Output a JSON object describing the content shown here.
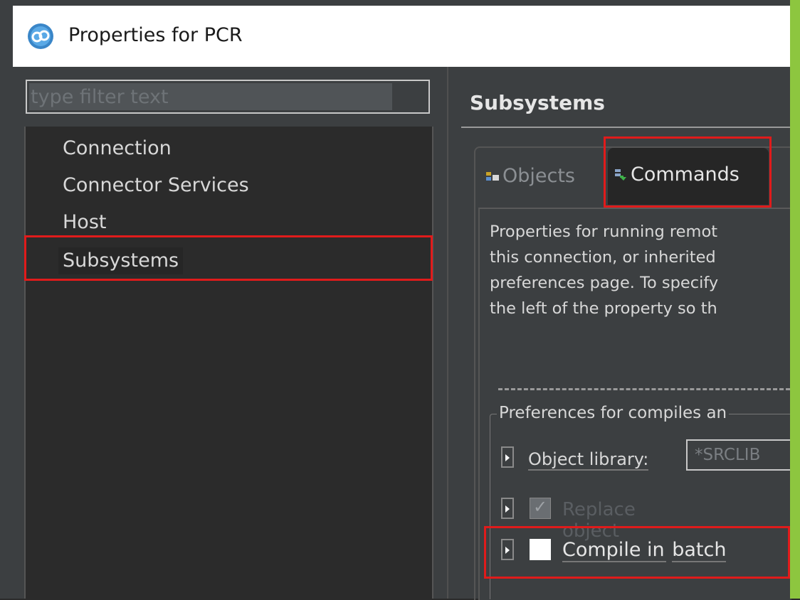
{
  "window": {
    "title": "Properties for PCR",
    "icon": "app-logo-icon"
  },
  "filter": {
    "placeholder": "type filter text"
  },
  "tree": {
    "items": [
      {
        "label": "Connection"
      },
      {
        "label": "Connector Services"
      },
      {
        "label": "Host"
      },
      {
        "label": "Subsystems",
        "selected": true
      }
    ]
  },
  "page": {
    "title": "Subsystems"
  },
  "tabs": [
    {
      "label": "Objects",
      "icon": "objects-icon",
      "active": false
    },
    {
      "label": "Commands",
      "icon": "commands-icon",
      "active": true
    }
  ],
  "description": {
    "lines": [
      "Properties for running remot",
      "this connection, or inherited",
      "preferences page. To specify",
      "the left of the property so th"
    ]
  },
  "group": {
    "label": "Preferences for compiles an",
    "object_library": {
      "label": "Object library:",
      "value": "*SRCLIB"
    },
    "replace_object": {
      "label": "Replace object",
      "checked": true,
      "enabled": false
    },
    "compile_in_batch": {
      "label_part1": "Compile in",
      "label_part2": "batch",
      "checked": false,
      "enabled": true
    }
  },
  "highlights": [
    "tree-subsystems",
    "tab-commands",
    "compile-in-batch"
  ],
  "colors": {
    "highlight": "#e01b1b",
    "accent_strip": "#8dc63f"
  }
}
